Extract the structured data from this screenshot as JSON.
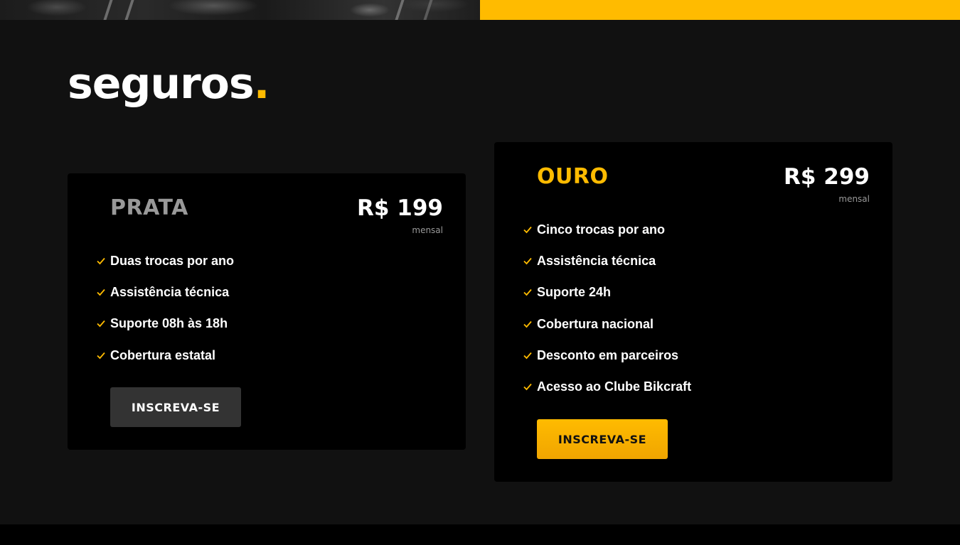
{
  "colors": {
    "accent": "#FFBB00",
    "background": "#111111",
    "card": "#000000",
    "muted": "#999999"
  },
  "section": {
    "title": "seguros",
    "title_dot": "."
  },
  "plans": [
    {
      "name": "PRATA",
      "price": "R$ 199",
      "period": "mensal",
      "features": [
        "Duas trocas por ano",
        "Assistência técnica",
        "Suporte 08h às 18h",
        "Cobertura estatal"
      ],
      "button_label": "INSCREVA-SE"
    },
    {
      "name": "OURO",
      "price": "R$ 299",
      "period": "mensal",
      "features": [
        "Cinco trocas por ano",
        "Assistência técnica",
        "Suporte 24h",
        "Cobertura nacional",
        "Desconto em parceiros",
        "Acesso ao Clube Bikcraft"
      ],
      "button_label": "INSCREVA-SE"
    }
  ],
  "icons": {
    "feature": "check-icon"
  }
}
